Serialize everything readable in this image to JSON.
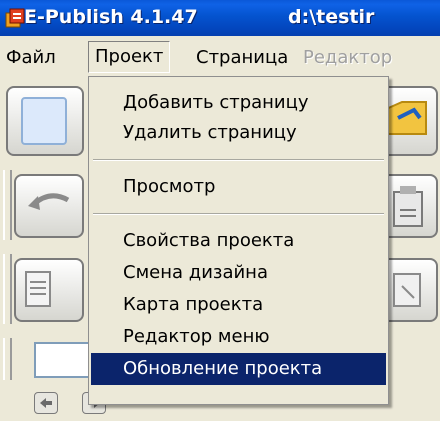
{
  "window": {
    "title": "E-Publish 4.1.47",
    "path": "d:\\testir"
  },
  "menubar": {
    "items": [
      {
        "label": "Файл"
      },
      {
        "label": "Проект"
      },
      {
        "label": "Страница"
      },
      {
        "label": "Редактор"
      }
    ],
    "open_menu": "Проект",
    "disabled_item": "Редактор"
  },
  "project_menu": {
    "items": [
      {
        "label": "Добавить страницу"
      },
      {
        "label": "Удалить страницу"
      },
      {
        "label": "Просмотр"
      },
      {
        "label": "Свойства проекта"
      },
      {
        "label": "Смена дизайна"
      },
      {
        "label": "Карта проекта"
      },
      {
        "label": "Редактор меню"
      },
      {
        "label": "Обновление проекта"
      }
    ],
    "highlighted_item": "Обновление проекта"
  },
  "colors": {
    "titlebar": "#0453cf",
    "menu_highlight": "#0b246b",
    "disabled_text": "#a0a0a0",
    "background": "#ece9d8"
  },
  "icons": [
    "app-icon",
    "new-page-icon",
    "open-folder-icon",
    "undo-icon",
    "paste-icon",
    "document-icon",
    "page-properties-icon",
    "back-arrow-icon",
    "forward-arrow-icon"
  ]
}
